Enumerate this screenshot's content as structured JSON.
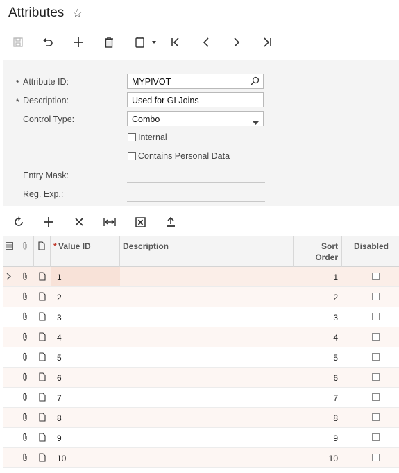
{
  "header": {
    "title": "Attributes",
    "star_icon": "star-icon"
  },
  "toolbar": {
    "icons": [
      "save-icon",
      "undo-icon",
      "add-icon",
      "delete-icon",
      "copy-paste-icon",
      "first-icon",
      "previous-icon",
      "next-icon",
      "last-icon"
    ]
  },
  "form": {
    "attribute_id": {
      "label": "Attribute ID:",
      "value": "MYPIVOT",
      "required": true
    },
    "description": {
      "label": "Description:",
      "value": "Used for GI Joins",
      "required": true
    },
    "control_type": {
      "label": "Control Type:",
      "value": "Combo"
    },
    "internal": {
      "label": "Internal",
      "checked": false
    },
    "personal_data": {
      "label": "Contains Personal Data",
      "checked": false
    },
    "entry_mask": {
      "label": "Entry Mask:",
      "value": ""
    },
    "reg_exp": {
      "label": "Reg. Exp.:",
      "value": ""
    }
  },
  "grid_toolbar": {
    "icons": [
      "refresh-icon",
      "add-row-icon",
      "delete-row-icon",
      "fit-columns-icon",
      "export-excel-icon",
      "upload-icon"
    ]
  },
  "grid": {
    "columns": {
      "value_id": "Value ID",
      "description": "Description",
      "sort_order_line1": "Sort",
      "sort_order_line2": "Order",
      "disabled": "Disabled"
    },
    "rows": [
      {
        "value_id": "1",
        "description": "",
        "sort_order": "1",
        "disabled": false
      },
      {
        "value_id": "2",
        "description": "",
        "sort_order": "2",
        "disabled": false
      },
      {
        "value_id": "3",
        "description": "",
        "sort_order": "3",
        "disabled": false
      },
      {
        "value_id": "4",
        "description": "",
        "sort_order": "4",
        "disabled": false
      },
      {
        "value_id": "5",
        "description": "",
        "sort_order": "5",
        "disabled": false
      },
      {
        "value_id": "6",
        "description": "",
        "sort_order": "6",
        "disabled": false
      },
      {
        "value_id": "7",
        "description": "",
        "sort_order": "7",
        "disabled": false
      },
      {
        "value_id": "8",
        "description": "",
        "sort_order": "8",
        "disabled": false
      },
      {
        "value_id": "9",
        "description": "",
        "sort_order": "9",
        "disabled": false
      },
      {
        "value_id": "10",
        "description": "",
        "sort_order": "10",
        "disabled": false
      }
    ]
  },
  "colors": {
    "accent_required": "#c0392b",
    "selected_row": "#fbeee8",
    "alt_row": "#fdf6f3"
  }
}
